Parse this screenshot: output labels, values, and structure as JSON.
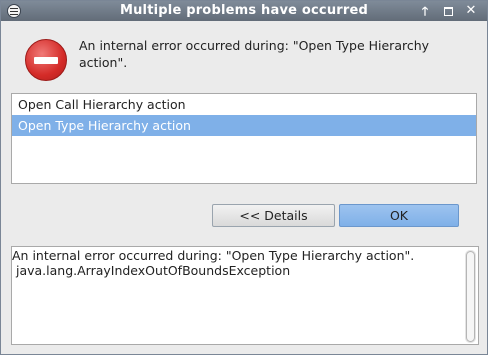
{
  "window": {
    "title": "Multiple problems have occurred",
    "controls": {
      "menu_icon": "window-menu-icon",
      "up_icon": "arrow-up-icon",
      "up_glyph": "🡑",
      "maximize_icon": "maximize-icon",
      "close_icon": "close-icon",
      "close_glyph": "✕"
    }
  },
  "message": {
    "icon": "error-icon",
    "text": "An internal error occurred during: \"Open Type Hierarchy action\"."
  },
  "problems": {
    "items": [
      {
        "label": "Open Call Hierarchy action",
        "selected": false
      },
      {
        "label": "Open Type Hierarchy action",
        "selected": true
      }
    ]
  },
  "buttons": {
    "details_label": "<< Details",
    "ok_label": "OK"
  },
  "details": {
    "text": "An internal error occurred during: \"Open Type Hierarchy action\".\n java.lang.ArrayIndexOutOfBoundsException"
  },
  "colors": {
    "selection": "#7fb0e8",
    "error_red": "#d42b28",
    "titlebar": "#6f7a87"
  }
}
